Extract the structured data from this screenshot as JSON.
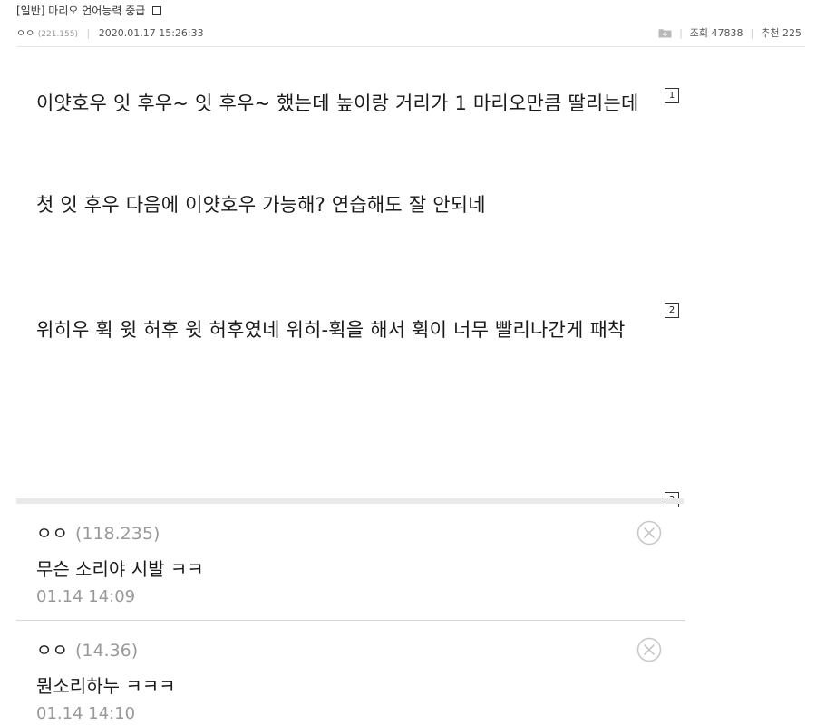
{
  "header": {
    "category": "[일반]",
    "title": "마리오 언어능력 중급",
    "author": "ㅇㅇ",
    "author_ip": "(221.155)",
    "date": "2020.01.17 15:26:33",
    "views_label": "조회",
    "views": "47838",
    "recommend_label": "추천",
    "recommend": "225",
    "icons": {
      "save": "folder-plus-icon"
    }
  },
  "body": {
    "paragraphs": [
      "이얏호우 잇 후우~ 잇 후우~ 했는데 높이랑 거리가 1 마리오만큼 딸리는데",
      "첫 잇 후우 다음에 이얏호우 가능해? 연습해도 잘 안되네",
      "위히우 휙 윗 허후 윗 허후였네 위히-휙을 해서 휙이 너무 빨리나간게 패착"
    ],
    "markers": [
      "1",
      "2",
      "3"
    ]
  },
  "comments": [
    {
      "author": "ㅇㅇ",
      "ip": "(118.235)",
      "text": "무슨 소리야 시발 ㅋㅋ",
      "time": "01.14 14:09",
      "icon": "delete-circle-icon"
    },
    {
      "author": "ㅇㅇ",
      "ip": "(14.36)",
      "text": "뭔소리하누 ㅋㅋㅋ",
      "time": "01.14 14:10",
      "icon": "delete-circle-icon"
    }
  ]
}
